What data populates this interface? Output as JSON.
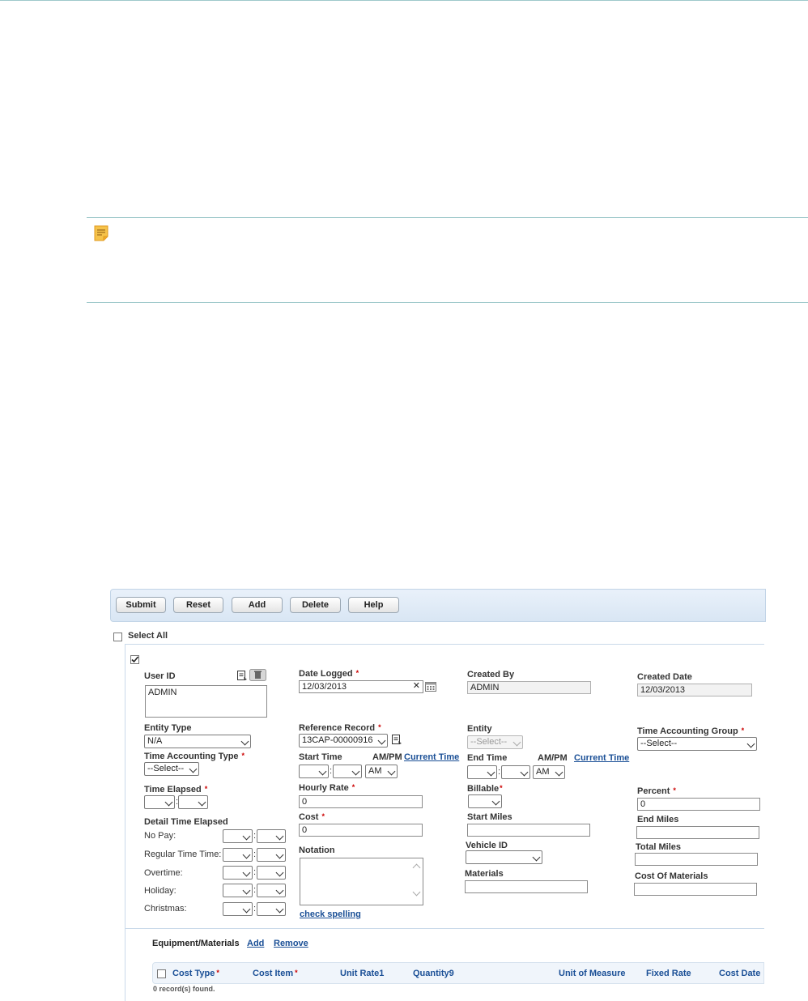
{
  "toolbar": {
    "submit": "Submit",
    "reset": "Reset",
    "add": "Add",
    "delete": "Delete",
    "help": "Help"
  },
  "select_all": "Select All",
  "form": {
    "user_id_label": "User ID",
    "user_id_value": "ADMIN",
    "date_logged_label": "Date Logged",
    "date_logged_value": "12/03/2013",
    "created_by_label": "Created By",
    "created_by_value": "ADMIN",
    "created_date_label": "Created Date",
    "created_date_value": "12/03/2013",
    "entity_type_label": "Entity Type",
    "entity_type_value": "N/A",
    "reference_record_label": "Reference Record",
    "reference_record_value": "13CAP-00000916",
    "entity_label": "Entity",
    "entity_value": "--Select--",
    "time_accounting_group_label": "Time Accounting Group",
    "time_accounting_group_value": "--Select--",
    "time_accounting_type_label": "Time Accounting Type",
    "time_accounting_type_value": "--Select--",
    "start_time_label": "Start Time",
    "ampm_label": "AM/PM",
    "current_time_link": "Current Time",
    "ampm_value": "AM",
    "end_time_label": "End Time",
    "time_elapsed_label": "Time Elapsed",
    "hourly_rate_label": "Hourly Rate",
    "hourly_rate_value": "0",
    "billable_label": "Billable",
    "percent_label": "Percent",
    "percent_value": "0",
    "detail_time_elapsed_label": "Detail Time Elapsed",
    "cost_label": "Cost",
    "cost_value": "0",
    "start_miles_label": "Start Miles",
    "end_miles_label": "End Miles",
    "detail_rows": [
      "No Pay:",
      "Regular Time Time:",
      "Overtime:",
      "Holiday:",
      "Christmas:"
    ],
    "notation_label": "Notation",
    "vehicle_id_label": "Vehicle ID",
    "total_miles_label": "Total Miles",
    "materials_label": "Materials",
    "cost_of_materials_label": "Cost Of Materials",
    "check_spelling": "check spelling",
    "required_mark": "*"
  },
  "equipment": {
    "title": "Equipment/Materials",
    "add": "Add",
    "remove": "Remove",
    "columns": [
      "Cost Type",
      "Cost Item",
      "Unit Rate1",
      "Quantity9",
      "Unit of Measure",
      "Fixed Rate",
      "Cost Date"
    ],
    "records_found": "0 record(s) found."
  },
  "colors": {
    "rule": "#9fc9cb",
    "link": "#1a4f96",
    "required": "#cc0000",
    "toolbar_bg": "#dfe9f5",
    "note_icon": "#f3b330"
  },
  "icons": [
    "note-icon",
    "lookup-icon",
    "delete-icon",
    "calendar-icon",
    "chevron-down-icon"
  ]
}
